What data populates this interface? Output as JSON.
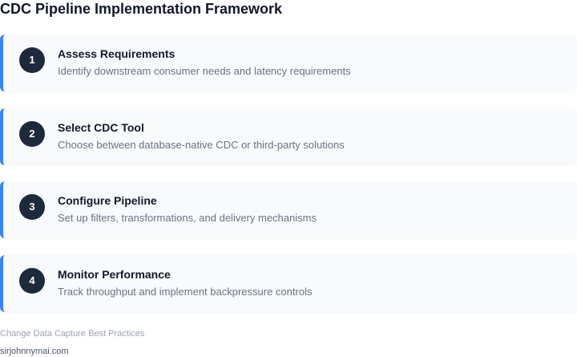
{
  "title": "CDC Pipeline Implementation Framework",
  "accent_color": "#3b82f6",
  "badge_color": "#1e293b",
  "steps": [
    {
      "number": "1",
      "title": "Assess Requirements",
      "description": "Identify downstream consumer needs and latency requirements"
    },
    {
      "number": "2",
      "title": "Select CDC Tool",
      "description": "Choose between database-native CDC or third-party solutions"
    },
    {
      "number": "3",
      "title": "Configure Pipeline",
      "description": "Set up filters, transformations, and delivery mechanisms"
    },
    {
      "number": "4",
      "title": "Monitor Performance",
      "description": "Track throughput and implement backpressure controls"
    }
  ],
  "footer": {
    "note": "Change Data Capture Best Practices",
    "site": "sirjohnnymai.com"
  }
}
